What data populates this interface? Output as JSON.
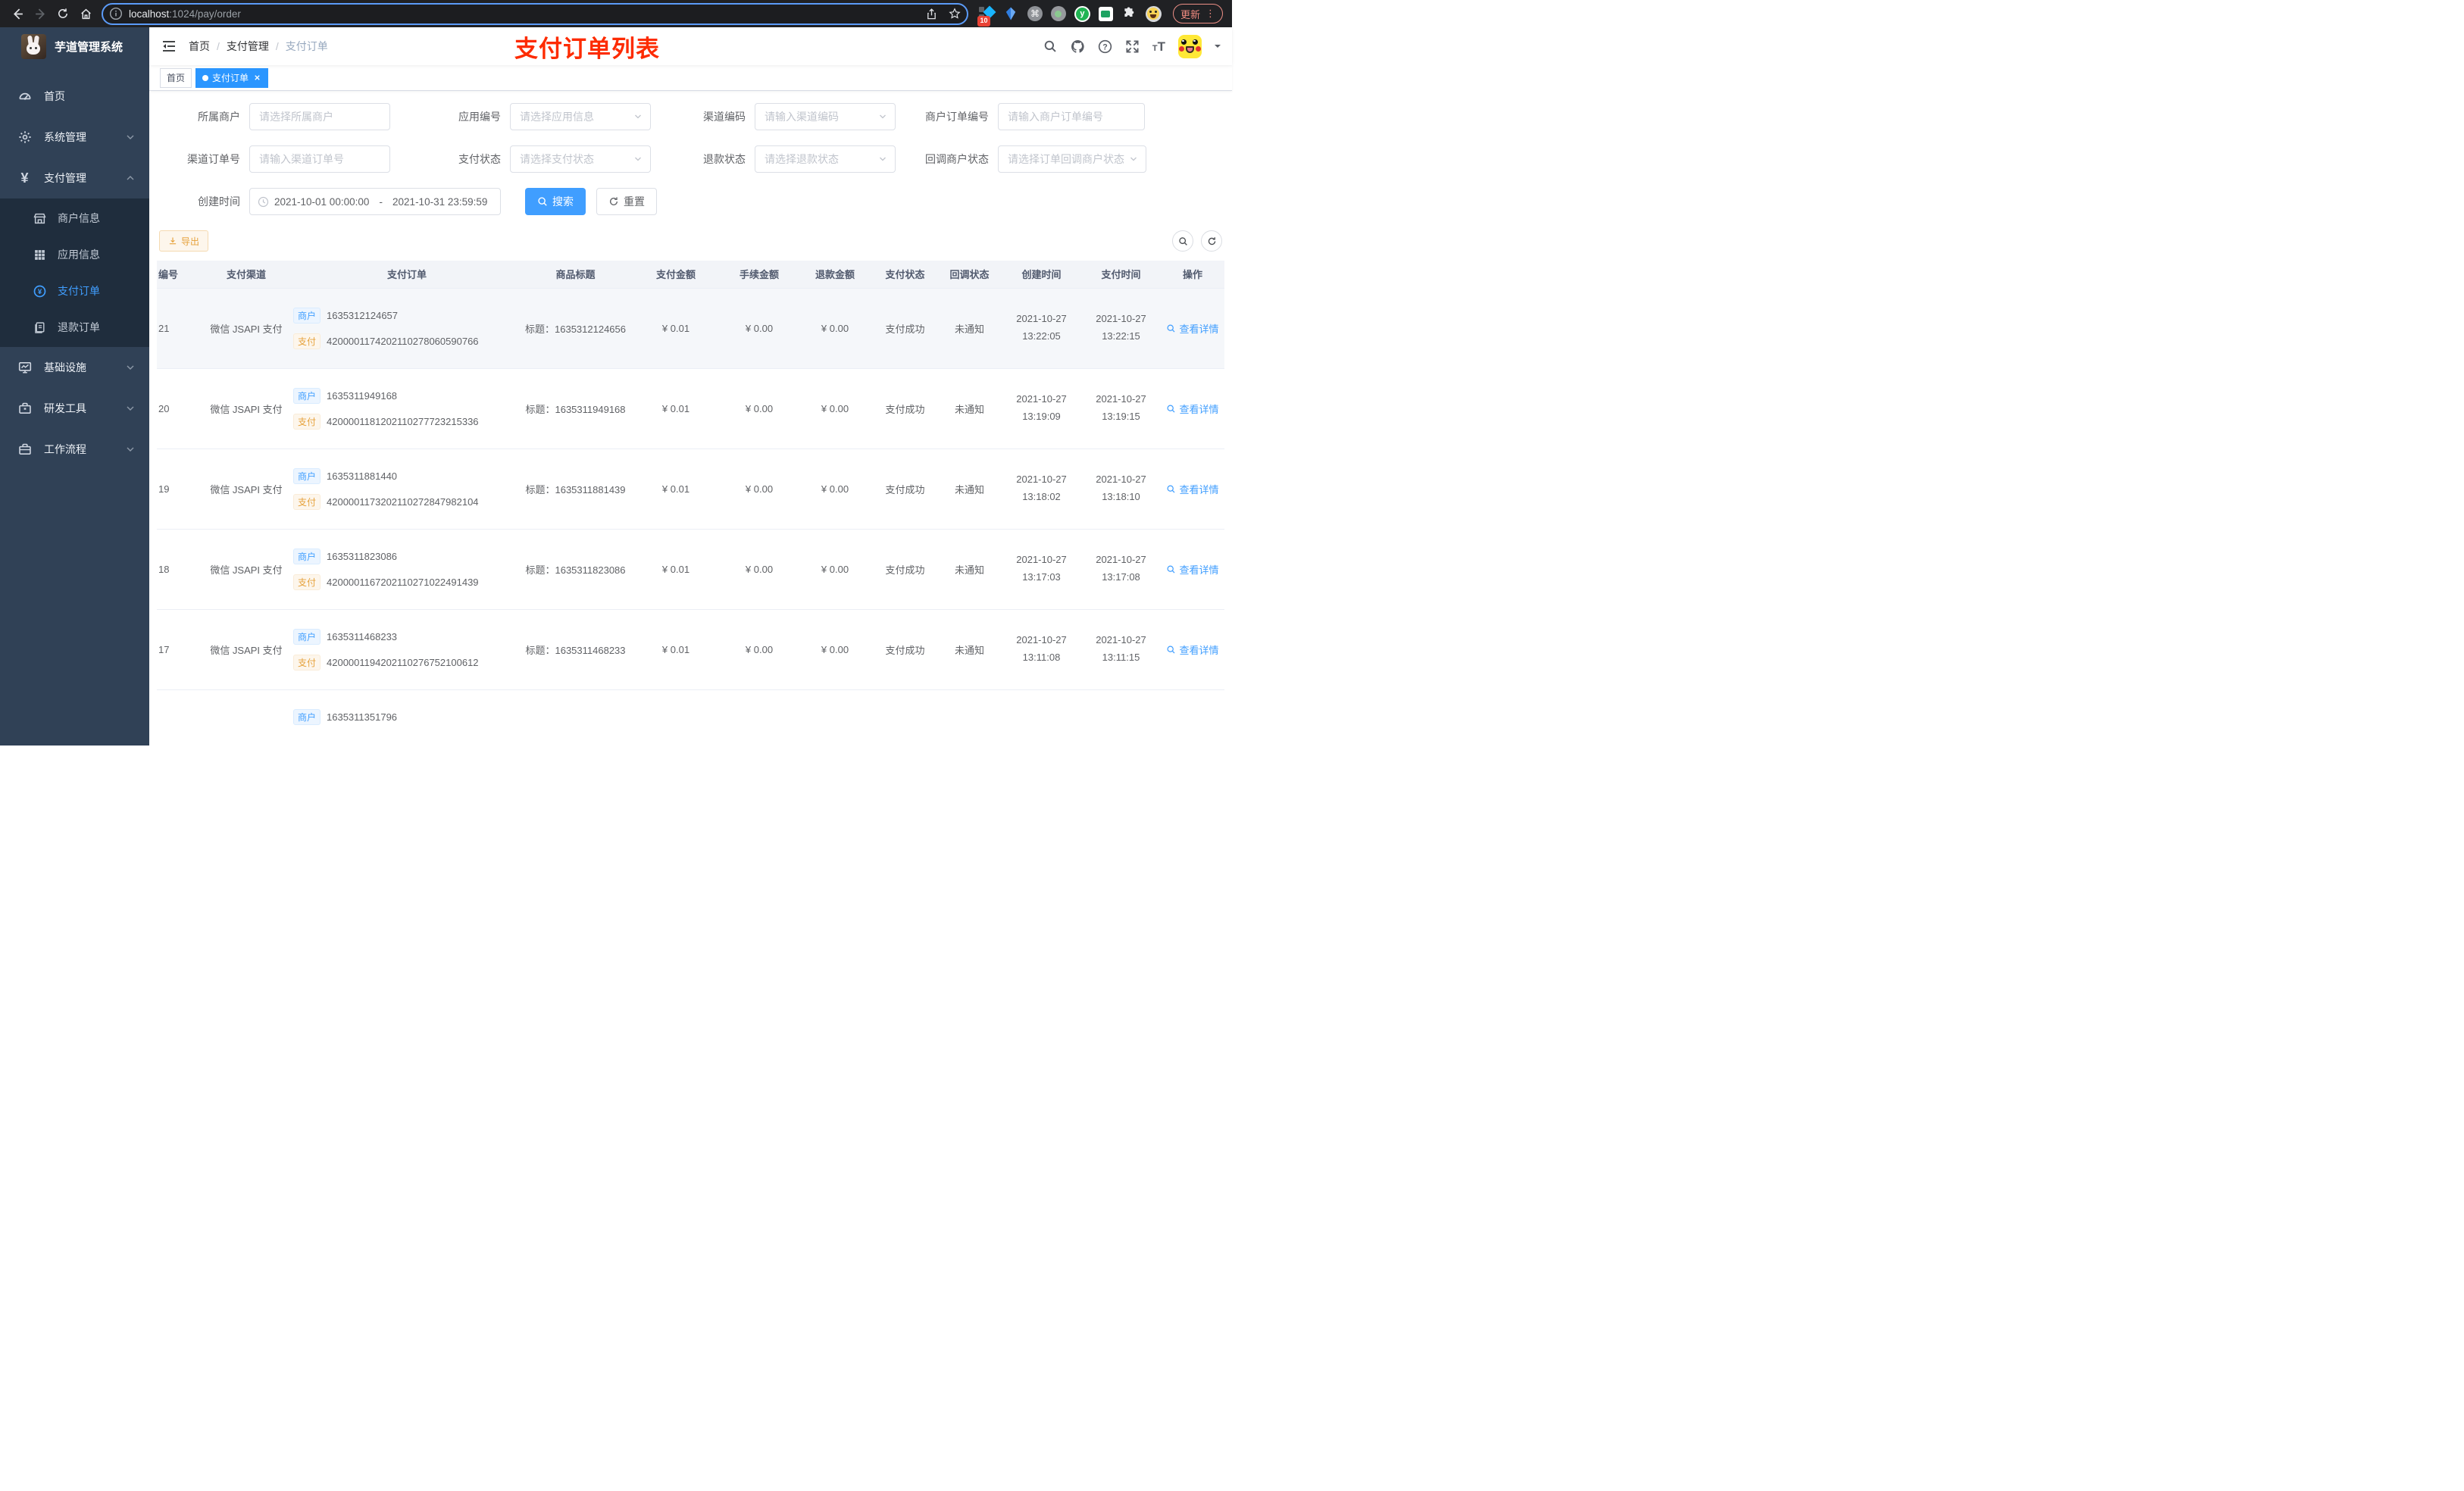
{
  "colors": {
    "accent": "#409eff",
    "warning": "#e6a23c",
    "annotation_red": "#fd2b00",
    "sidebar_bg": "#304156",
    "submenu_bg": "#1f2d3d",
    "active_tag_bg": "#2b96ff"
  },
  "browser": {
    "url_host": "localhost",
    "url_path": ":1024/pay/order",
    "extension_badge": "10",
    "update_label": "更新",
    "menu_glyph": "⋮",
    "command_glyph": "⌘",
    "y_extension_glyph": "y"
  },
  "sidebar": {
    "app_title": "芋道管理系统",
    "items": [
      {
        "label": "首页",
        "icon": "dashboard"
      },
      {
        "label": "系统管理",
        "icon": "gear",
        "expand": "down"
      },
      {
        "label": "支付管理",
        "icon": "yen",
        "expand": "up"
      },
      {
        "label": "基础设施",
        "icon": "monitor",
        "expand": "down"
      },
      {
        "label": "研发工具",
        "icon": "toolbox",
        "expand": "down"
      },
      {
        "label": "工作流程",
        "icon": "briefcase",
        "expand": "down"
      }
    ],
    "pay_submenu": [
      {
        "label": "商户信息",
        "icon": "shop"
      },
      {
        "label": "应用信息",
        "icon": "grid"
      },
      {
        "label": "支付订单",
        "icon": "circled-yen",
        "active": true
      },
      {
        "label": "退款订单",
        "icon": "document"
      }
    ],
    "yen_glyph": "¥"
  },
  "header": {
    "breadcrumb": {
      "items": [
        "首页",
        "支付管理",
        "支付订单"
      ],
      "separator": "/"
    },
    "annotation": "支付订单列表",
    "font_size_glyph_small": "T",
    "font_size_glyph_big": "T"
  },
  "tags": [
    {
      "label": "首页",
      "active": false
    },
    {
      "label": "支付订单",
      "active": true
    }
  ],
  "filters": {
    "fields": [
      {
        "label": "所属商户",
        "placeholder": "请选择所属商户",
        "type": "input"
      },
      {
        "label": "应用编号",
        "placeholder": "请选择应用信息",
        "type": "select"
      },
      {
        "label": "渠道编码",
        "placeholder": "请输入渠道编码",
        "type": "select"
      },
      {
        "label": "商户订单编号",
        "placeholder": "请输入商户订单编号",
        "type": "input"
      },
      {
        "label": "渠道订单号",
        "placeholder": "请输入渠道订单号",
        "type": "input"
      },
      {
        "label": "支付状态",
        "placeholder": "请选择支付状态",
        "type": "select"
      },
      {
        "label": "退款状态",
        "placeholder": "请选择退款状态",
        "type": "select"
      },
      {
        "label": "回调商户状态",
        "placeholder": "请选择订单回调商户状态",
        "type": "select"
      }
    ],
    "date_label": "创建时间",
    "date_start": "2021-10-01 00:00:00",
    "date_separator": "-",
    "date_end": "2021-10-31 23:59:59",
    "search_label": "搜索",
    "reset_label": "重置"
  },
  "toolbar": {
    "export_label": "导出"
  },
  "table": {
    "headers": [
      "编号",
      "支付渠道",
      "支付订单",
      "商品标题",
      "支付金额",
      "手续金额",
      "退款金额",
      "支付状态",
      "回调状态",
      "创建时间",
      "支付时间",
      "操作"
    ],
    "tag_merchant": "商户",
    "tag_pay": "支付",
    "rows": [
      {
        "id": "21",
        "channel": "微信 JSAPI 支付",
        "merchant_no": "1635312124657",
        "pay_no": "4200001174202110278060590766",
        "product_title": "标题：1635312124656",
        "amount": "¥ 0.01",
        "fee": "¥ 0.00",
        "refund": "¥ 0.00",
        "status": "支付成功",
        "notify": "未通知",
        "created_date": "2021-10-27",
        "created_time": "13:22:05",
        "paid_date": "2021-10-27",
        "paid_time": "13:22:15",
        "action": "查看详情",
        "highlighted": true
      },
      {
        "id": "20",
        "channel": "微信 JSAPI 支付",
        "merchant_no": "1635311949168",
        "pay_no": "4200001181202110277723215336",
        "product_title": "标题：1635311949168",
        "amount": "¥ 0.01",
        "fee": "¥ 0.00",
        "refund": "¥ 0.00",
        "status": "支付成功",
        "notify": "未通知",
        "created_date": "2021-10-27",
        "created_time": "13:19:09",
        "paid_date": "2021-10-27",
        "paid_time": "13:19:15",
        "action": "查看详情"
      },
      {
        "id": "19",
        "channel": "微信 JSAPI 支付",
        "merchant_no": "1635311881440",
        "pay_no": "4200001173202110272847982104",
        "product_title": "标题：1635311881439",
        "amount": "¥ 0.01",
        "fee": "¥ 0.00",
        "refund": "¥ 0.00",
        "status": "支付成功",
        "notify": "未通知",
        "created_date": "2021-10-27",
        "created_time": "13:18:02",
        "paid_date": "2021-10-27",
        "paid_time": "13:18:10",
        "action": "查看详情"
      },
      {
        "id": "18",
        "channel": "微信 JSAPI 支付",
        "merchant_no": "1635311823086",
        "pay_no": "4200001167202110271022491439",
        "product_title": "标题：1635311823086",
        "amount": "¥ 0.01",
        "fee": "¥ 0.00",
        "refund": "¥ 0.00",
        "status": "支付成功",
        "notify": "未通知",
        "created_date": "2021-10-27",
        "created_time": "13:17:03",
        "paid_date": "2021-10-27",
        "paid_time": "13:17:08",
        "action": "查看详情"
      },
      {
        "id": "17",
        "channel": "微信 JSAPI 支付",
        "merchant_no": "1635311468233",
        "pay_no": "4200001194202110276752100612",
        "product_title": "标题：1635311468233",
        "amount": "¥ 0.01",
        "fee": "¥ 0.00",
        "refund": "¥ 0.00",
        "status": "支付成功",
        "notify": "未通知",
        "created_date": "2021-10-27",
        "created_time": "13:11:08",
        "paid_date": "2021-10-27",
        "paid_time": "13:11:15",
        "action": "查看详情"
      },
      {
        "id": "",
        "channel": "",
        "merchant_no": "1635311351796",
        "pay_no": "",
        "product_title": "",
        "amount": "",
        "fee": "",
        "refund": "",
        "status": "",
        "notify": "",
        "created_date": "",
        "created_time": "",
        "paid_date": "",
        "paid_time": "",
        "action": ""
      }
    ]
  }
}
